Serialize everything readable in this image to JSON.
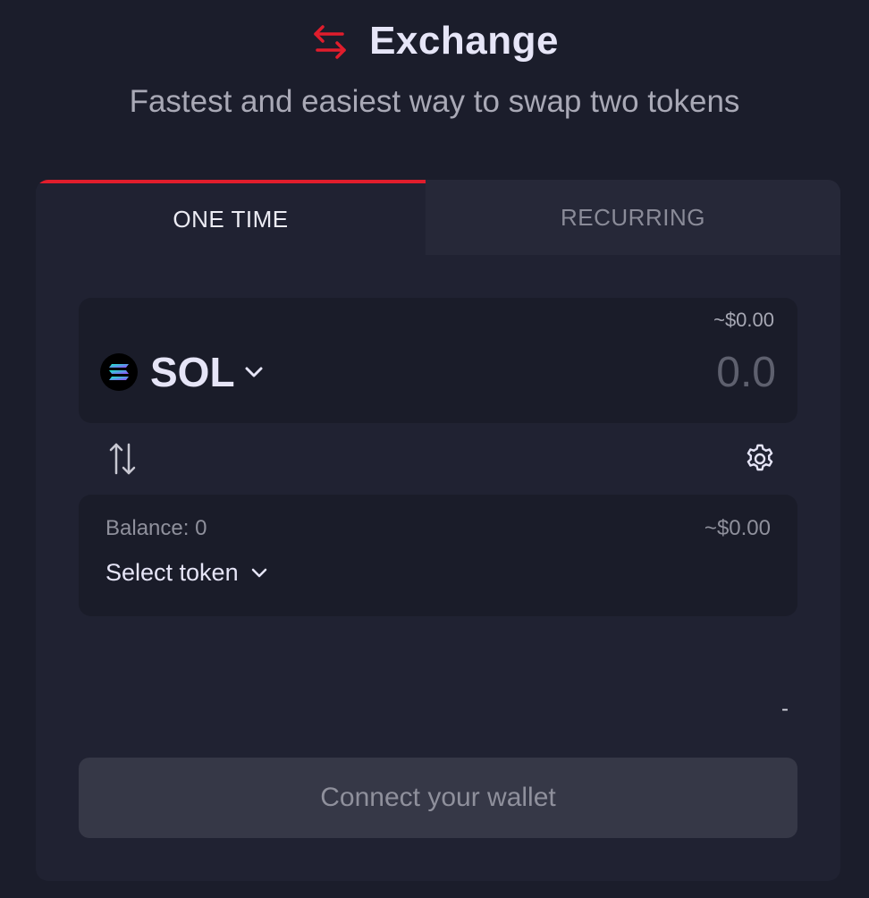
{
  "header": {
    "title": "Exchange",
    "subtitle": "Fastest and easiest way to swap two tokens",
    "icon": "swap-arrows-icon",
    "accent_color": "#e01d2c"
  },
  "tabs": [
    {
      "label": "ONE TIME",
      "active": true
    },
    {
      "label": "RECURRING",
      "active": false
    }
  ],
  "from": {
    "usd_value": "~$0.00",
    "token": "SOL",
    "amount_placeholder": "0.0"
  },
  "to": {
    "balance_label": "Balance: 0",
    "usd_value": "~$0.00",
    "select_label": "Select token"
  },
  "rate_value": "-",
  "connect_button": "Connect your wallet"
}
